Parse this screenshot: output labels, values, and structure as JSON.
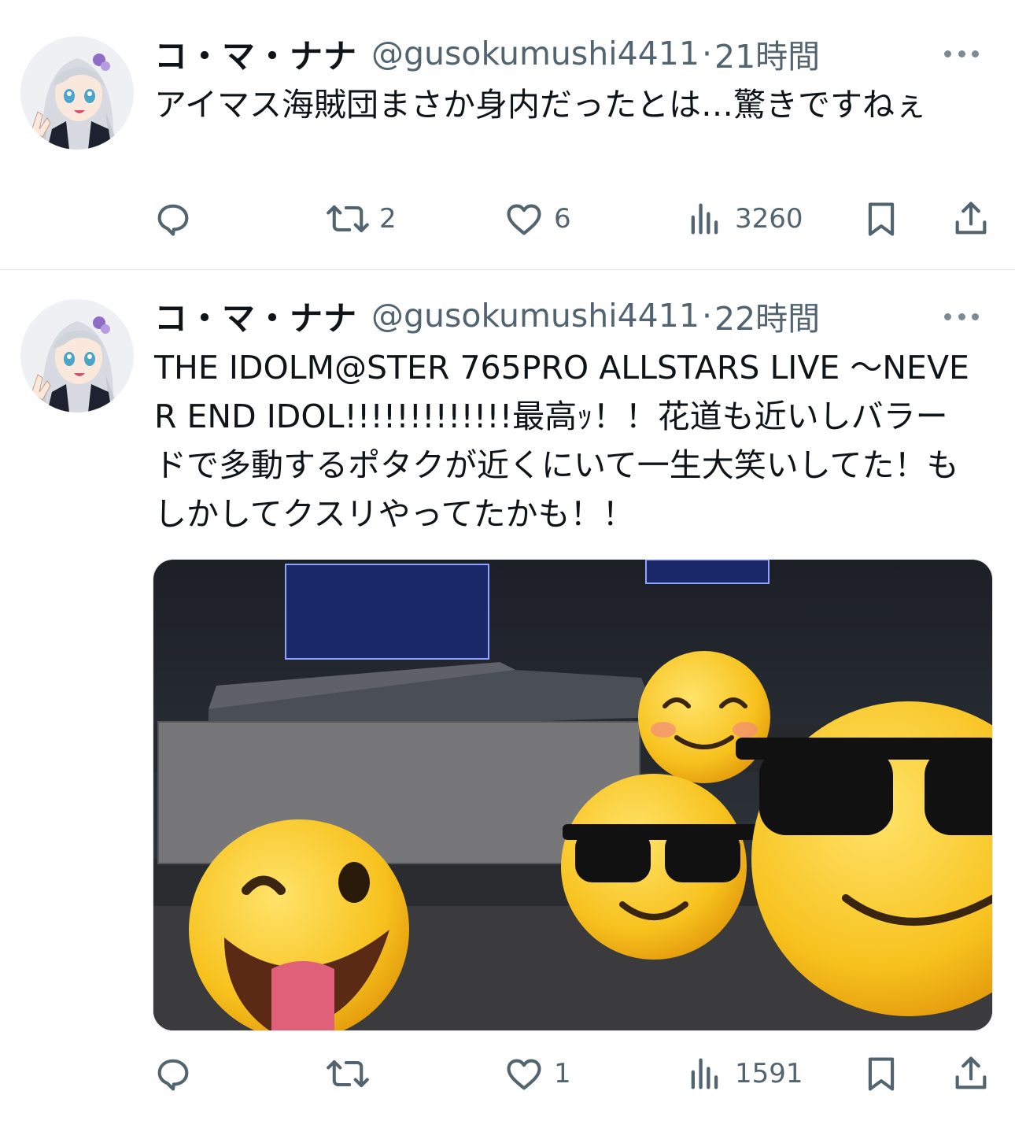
{
  "colors": {
    "text_primary": "#0f1419",
    "text_secondary": "#536471",
    "divider": "#e1e6ea"
  },
  "tweets": [
    {
      "author_name": "コ・マ・ナナ",
      "handle": "@gusokumushi4411",
      "separator": "·",
      "time": "21時間",
      "text": "アイマス海賊団まさか身内だったとは…驚きですねぇ",
      "reply_count": "",
      "retweet_count": "2",
      "like_count": "6",
      "view_count": "3260",
      "icons": [
        "reply-icon",
        "retweet-icon",
        "like-icon",
        "views-icon",
        "bookmark-icon",
        "share-icon",
        "more-icon"
      ]
    },
    {
      "author_name": "コ・マ・ナナ",
      "handle": "@gusokumushi4411",
      "separator": "·",
      "time": "22時間",
      "text": "THE IDOLM@STER 765PRO ALLSTARS LIVE 〜NEVER END IDOL!!!!!!!!!!!!!最高ｯ！！花道も近いしバラードで多動するポタクが近くにいて一生大笑いしてた！もしかしてクスリやってたかも！！",
      "has_media": true,
      "media_description_hidden": true,
      "reply_count": "",
      "retweet_count": "",
      "like_count": "1",
      "view_count": "1591",
      "icons": [
        "reply-icon",
        "retweet-icon",
        "like-icon",
        "views-icon",
        "bookmark-icon",
        "share-icon",
        "more-icon"
      ]
    }
  ]
}
